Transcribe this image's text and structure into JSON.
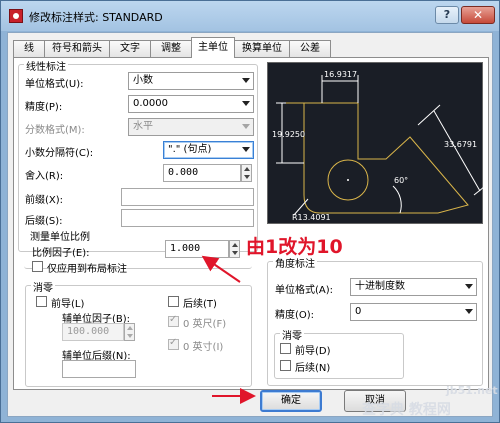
{
  "window": {
    "title": "修改标注样式: STANDARD",
    "help": "?",
    "close": "✕"
  },
  "tabs": [
    "线",
    "符号和箭头",
    "文字",
    "调整",
    "主单位",
    "换算单位",
    "公差"
  ],
  "linear": {
    "group_title": "线性标注",
    "unit_format_label": "单位格式(U):",
    "unit_format_value": "小数",
    "precision_label": "精度(P):",
    "precision_value": "0.0000",
    "fraction_format_label": "分数格式(M):",
    "fraction_format_value": "水平",
    "decimal_sep_label": "小数分隔符(C):",
    "decimal_sep_value": "\".\"  (句点)",
    "round_off_label": "舍入(R):",
    "round_off_value": "0.000",
    "prefix_label": "前缀(X):",
    "prefix_value": "",
    "suffix_label": "后缀(S):",
    "suffix_value": ""
  },
  "measurement_scale": {
    "group_title": "测量单位比例",
    "scale_factor_label": "比例因子(E):",
    "scale_factor_value": "1.000",
    "layout_only_label": "仅应用到布局标注"
  },
  "zero_suppression": {
    "group_title": "消零",
    "leading_label": "前导(L)",
    "sub_unit_factor_label": "辅单位因子(B):",
    "sub_unit_factor_value": "100.000",
    "sub_unit_suffix_label": "辅单位后缀(N):",
    "sub_unit_suffix_value": "",
    "trailing_label": "后续(T)",
    "feet_label": "0 英尺(F)",
    "inches_label": "0 英寸(I)"
  },
  "preview": {
    "dim_top": "16.9317",
    "dim_left": "19.9250",
    "dim_right": "33.6791",
    "dim_angle": "60°",
    "dim_radius": "R13.4091"
  },
  "angular": {
    "group_title": "角度标注",
    "unit_format_label": "单位格式(A):",
    "unit_format_value": "十进制度数",
    "precision_label": "精度(O):",
    "precision_value": "0",
    "zero_group_title": "消零",
    "leading_label": "前导(D)",
    "trailing_label": "后续(N)"
  },
  "buttons": {
    "ok": "确定",
    "cancel": "取消"
  },
  "annotation": {
    "text": "由1改为10"
  },
  "watermark": {
    "line1": "jb51.net",
    "line2": "查字典 教程网"
  },
  "colors": {
    "preview_bg": "#1a1e26",
    "preview_line": "#d9b54a",
    "annotation": "#e0152a"
  }
}
